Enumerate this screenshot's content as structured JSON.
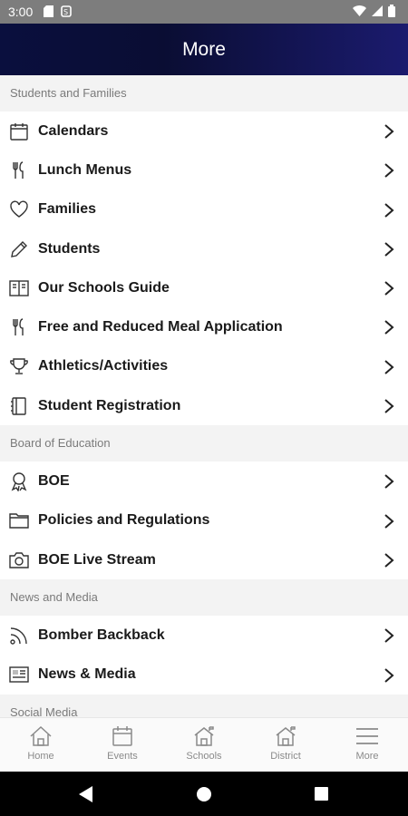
{
  "status_bar": {
    "time": "3:00"
  },
  "app_bar": {
    "title": "More"
  },
  "sections": [
    {
      "header": "Students and Families",
      "items": [
        {
          "label": "Calendars",
          "icon": "calendar-icon"
        },
        {
          "label": "Lunch Menus",
          "icon": "utensils-icon"
        },
        {
          "label": "Families",
          "icon": "heart-icon"
        },
        {
          "label": "Students",
          "icon": "pencil-icon"
        },
        {
          "label": "Our Schools Guide",
          "icon": "book-icon"
        },
        {
          "label": "Free and Reduced Meal Application",
          "icon": "utensils-icon"
        },
        {
          "label": "Athletics/Activities",
          "icon": "trophy-icon"
        },
        {
          "label": "Student Registration",
          "icon": "notebook-icon"
        }
      ]
    },
    {
      "header": "Board of Education",
      "items": [
        {
          "label": "BOE",
          "icon": "award-icon"
        },
        {
          "label": "Policies and Regulations",
          "icon": "folder-icon"
        },
        {
          "label": "BOE Live Stream",
          "icon": "camera-icon"
        }
      ]
    },
    {
      "header": "News and Media",
      "items": [
        {
          "label": "Bomber Backback",
          "icon": "rss-icon"
        },
        {
          "label": "News & Media",
          "icon": "newspaper-icon"
        }
      ]
    },
    {
      "header": "Social Media",
      "items": []
    }
  ],
  "bottom_nav": [
    {
      "label": "Home",
      "icon": "home-icon"
    },
    {
      "label": "Events",
      "icon": "events-icon"
    },
    {
      "label": "Schools",
      "icon": "school-icon"
    },
    {
      "label": "District",
      "icon": "district-icon"
    },
    {
      "label": "More",
      "icon": "menu-icon"
    }
  ]
}
